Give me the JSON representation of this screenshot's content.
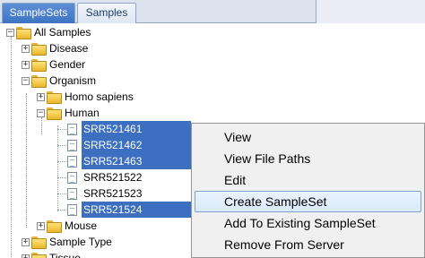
{
  "tabs": [
    {
      "label": "SampleSets",
      "active": true
    },
    {
      "label": "Samples",
      "active": false
    }
  ],
  "tree": {
    "root": "All Samples",
    "disease": "Disease",
    "gender": "Gender",
    "organism": "Organism",
    "homo_sapiens": "Homo sapiens",
    "human": "Human",
    "samples": [
      "SRR521461",
      "SRR521462",
      "SRR521463",
      "SRR521522",
      "SRR521523",
      "SRR521524"
    ],
    "selected_samples": [
      "SRR521461",
      "SRR521462",
      "SRR521463",
      "SRR521524"
    ],
    "mouse": "Mouse",
    "sample_type": "Sample Type",
    "tissue": "Tissue",
    "icons": {
      "folder": "folder-icon",
      "document": "document-icon",
      "expanded": "minus",
      "collapsed": "plus"
    }
  },
  "context_menu": {
    "items": [
      "View",
      "View File Paths",
      "Edit",
      "Create SampleSet",
      "Add To Existing SampleSet",
      "Remove From Server"
    ],
    "highlighted": "Create SampleSet"
  },
  "colors": {
    "selection": "#3c6fbf",
    "menu_highlight_border": "#7da2ce",
    "folder": "#e9b82c"
  }
}
